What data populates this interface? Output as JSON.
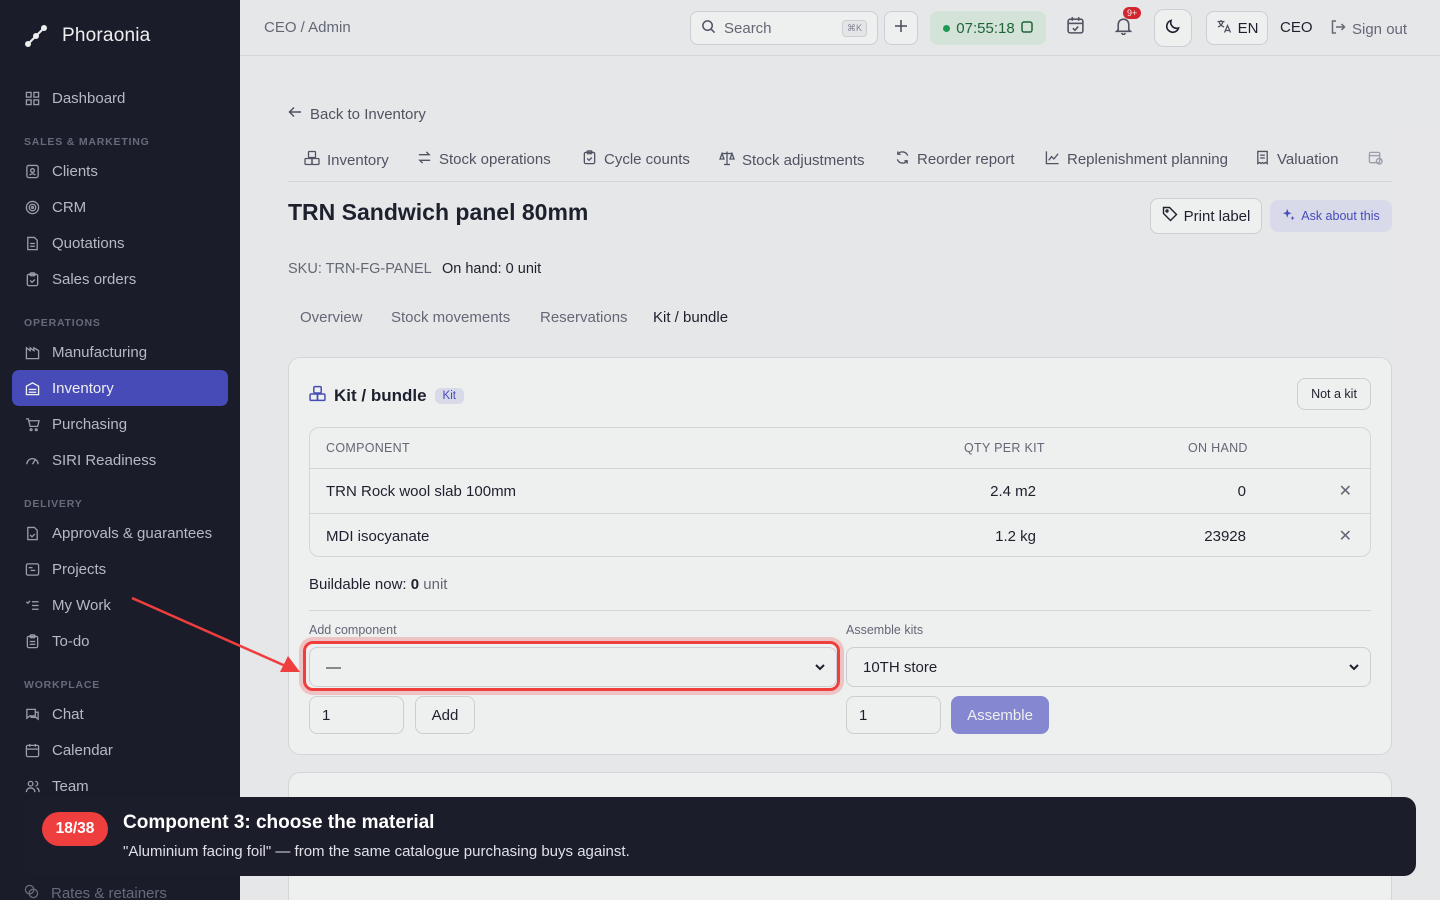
{
  "brand": {
    "name": "Phoraonia"
  },
  "sidebar": {
    "items": [
      {
        "label": "Dashboard",
        "icon": "grid-icon"
      },
      {
        "label": "Clients",
        "icon": "contact-icon"
      },
      {
        "label": "CRM",
        "icon": "target-icon"
      },
      {
        "label": "Quotations",
        "icon": "document-icon"
      },
      {
        "label": "Sales orders",
        "icon": "clipboard-icon"
      },
      {
        "label": "Manufacturing",
        "icon": "factory-icon"
      },
      {
        "label": "Inventory",
        "icon": "warehouse-icon"
      },
      {
        "label": "Purchasing",
        "icon": "cart-icon"
      },
      {
        "label": "SIRI Readiness",
        "icon": "gauge-icon"
      },
      {
        "label": "Approvals & guarantees",
        "icon": "file-check-icon"
      },
      {
        "label": "Projects",
        "icon": "gantt-icon"
      },
      {
        "label": "My Work",
        "icon": "list-check-icon"
      },
      {
        "label": "To-do",
        "icon": "clipboard-list-icon"
      },
      {
        "label": "Chat",
        "icon": "chat-icon"
      },
      {
        "label": "Calendar",
        "icon": "calendar-icon"
      },
      {
        "label": "Team",
        "icon": "users-icon"
      },
      {
        "label": "Rates & retainers",
        "icon": "coins-icon"
      }
    ],
    "sections": {
      "sales": "SALES & MARKETING",
      "operations": "OPERATIONS",
      "delivery": "DELIVERY",
      "workplace": "WORKPLACE"
    }
  },
  "topbar": {
    "breadcrumb": "CEO / Admin",
    "search_label": "Search",
    "search_shortcut": "⌘K",
    "timer": "07:55:18",
    "notifications_badge": "9+",
    "language": "EN",
    "user": "CEO",
    "signout": "Sign out"
  },
  "main": {
    "back_link": "Back to Inventory",
    "tabs": [
      {
        "label": "Inventory",
        "icon": "boxes-icon"
      },
      {
        "label": "Stock operations",
        "icon": "arrows-icon"
      },
      {
        "label": "Cycle counts",
        "icon": "clipboard-check-icon"
      },
      {
        "label": "Stock adjustments",
        "icon": "scale-icon"
      },
      {
        "label": "Reorder report",
        "icon": "refresh-icon"
      },
      {
        "label": "Replenishment planning",
        "icon": "chart-icon"
      },
      {
        "label": "Valuation",
        "icon": "receipt-icon"
      }
    ],
    "title": "TRN Sandwich panel 80mm",
    "print_label": "Print label",
    "ask_label": "Ask about this",
    "sku": "SKU: TRN-FG-PANEL",
    "on_hand": "On hand: 0 unit",
    "subtabs": [
      "Overview",
      "Stock movements",
      "Reservations",
      "Kit / bundle"
    ]
  },
  "kit": {
    "title": "Kit / bundle",
    "pill": "Kit",
    "not_kit_button": "Not a kit",
    "columns": [
      "COMPONENT",
      "QTY PER KIT",
      "ON HAND"
    ],
    "rows": [
      {
        "component": "TRN Rock wool slab 100mm",
        "qty": "2.4 m2",
        "on_hand": "0"
      },
      {
        "component": "MDI isocyanate",
        "qty": "1.2 kg",
        "on_hand": "23928"
      }
    ],
    "buildable_label": "Buildable now:",
    "buildable_value": "0",
    "buildable_unit": "unit",
    "add_component_label": "Add component",
    "add_component_value": "—",
    "add_qty": "1",
    "add_button": "Add",
    "assemble_label": "Assemble kits",
    "assemble_store": "10TH store",
    "assemble_qty": "1",
    "assemble_button": "Assemble"
  },
  "tour": {
    "step": "18/38",
    "title": "Component 3: choose the material",
    "text": "\"Aluminium facing foil\" — from the same catalogue purchasing buys against."
  },
  "colors": {
    "sidebar_bg": "#1b1d2a",
    "accent": "#4b4fc4",
    "highlight": "#ef3e3e",
    "timer_bg": "#e3f3e7"
  }
}
